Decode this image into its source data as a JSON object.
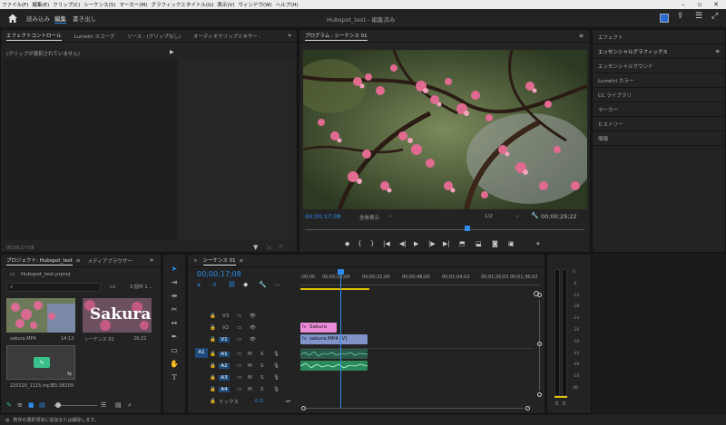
{
  "menu": [
    "ファイル(F)",
    "編集(E)",
    "クリップ(C)",
    "シーケンス(S)",
    "マーカー(M)",
    "グラフィックとタイトル(G)",
    "表示(V)",
    "ウィンドウ(W)",
    "ヘルプ(H)"
  ],
  "header": {
    "home_icon": "home-icon",
    "tabs": [
      "読み込み",
      "編集",
      "書き出し"
    ],
    "active_tab": "編集",
    "title": "Hubspot_test - 編集済み"
  },
  "effect_controls": {
    "tabs": [
      "エフェクトコントロール",
      "Lumetri スコープ",
      "ソース : (クリップなし)",
      "オーディオクリップミキサー :"
    ],
    "message": "(クリップが選択されていません)",
    "timecode": "00;00;17;08"
  },
  "program": {
    "title": "プログラム : シーケンス 01",
    "timecode": "00;00;17;08",
    "fit": "全体表示",
    "quality": "1/2",
    "duration": "00;00;29;22",
    "playhead_fraction": 0.58
  },
  "right_panel": [
    "エフェクト",
    "エッセンシャルグラフィックス",
    "エッセンシャルサウンド",
    "Lumetri カラー",
    "CC ライブラリ",
    "マーカー",
    "ヒストリー",
    "情報"
  ],
  "project": {
    "tabs": [
      "プロジェクト: Hubspot_test",
      "メディアブラウザー"
    ],
    "file": "Hubspot_test.prproj",
    "count": "3 個中 1 ...",
    "items": [
      {
        "name": "sakura.MP4",
        "duration": "14:12"
      },
      {
        "name": "シーケンス 01",
        "duration": "29:22"
      },
      {
        "name": "220120_1115.mp3",
        "duration": "55:38109"
      }
    ],
    "title_thumb": "Sakura"
  },
  "timeline": {
    "tab": "シーケンス 01",
    "timecode": "00;00;17;08",
    "ruler": [
      ";00;00",
      "00;00;16;00",
      "00;00;32;00",
      "00;00;48;00",
      "00;01;04;02",
      "00;01;20;02",
      "00;01;36;02"
    ],
    "video_tracks": [
      "V3",
      "V2",
      "V1"
    ],
    "audio_tracks": [
      "A1",
      "A2",
      "A3",
      "A4"
    ],
    "source_patch": "A1",
    "mix_label": "ミックス",
    "mix_value": "0.0",
    "clips": {
      "title": "Sakura",
      "video": "sakura.MP4 [V]"
    }
  },
  "meter": {
    "scale": [
      "0",
      "-6",
      "-12",
      "-18",
      "-24",
      "-30",
      "-36",
      "-42",
      "-48",
      "-54",
      "dB"
    ],
    "channels": [
      "S",
      "S"
    ]
  },
  "status": "既存の選択項目に追加または解除します。",
  "colors": {
    "blue": "#2d8ceb",
    "clip_pink": "#e88ad6",
    "clip_video": "#7f93c9",
    "clip_audio": "#2a8a5a",
    "playhead": "#2d8ceb"
  }
}
